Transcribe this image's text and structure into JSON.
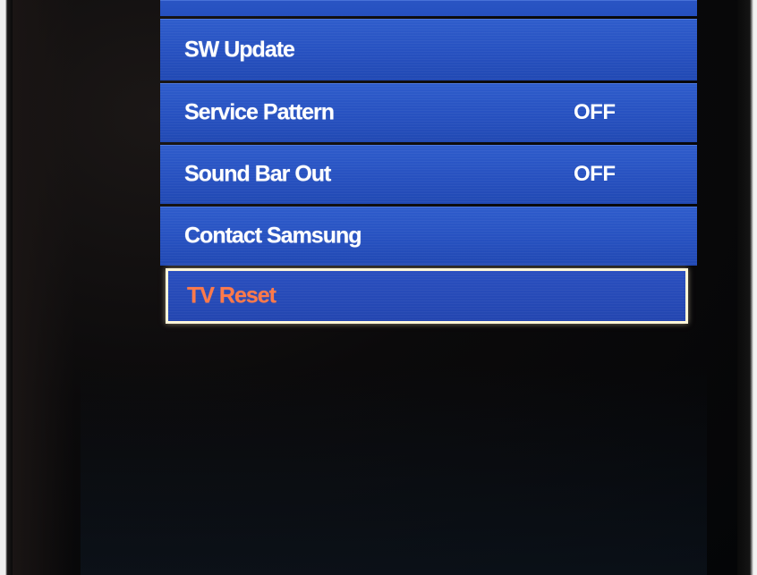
{
  "menu": {
    "items": [
      {
        "label": "SW Update",
        "value": ""
      },
      {
        "label": "Service Pattern",
        "value": "OFF"
      },
      {
        "label": "Sound Bar Out",
        "value": "OFF"
      },
      {
        "label": "Contact Samsung",
        "value": ""
      },
      {
        "label": "TV Reset",
        "value": "",
        "selected": true
      }
    ]
  },
  "colors": {
    "menu_bg": "#2751c0",
    "item_text": "#ffffff",
    "selected_text": "#ff7a4a",
    "selected_border": "#fff6d8",
    "background": "#050506"
  }
}
